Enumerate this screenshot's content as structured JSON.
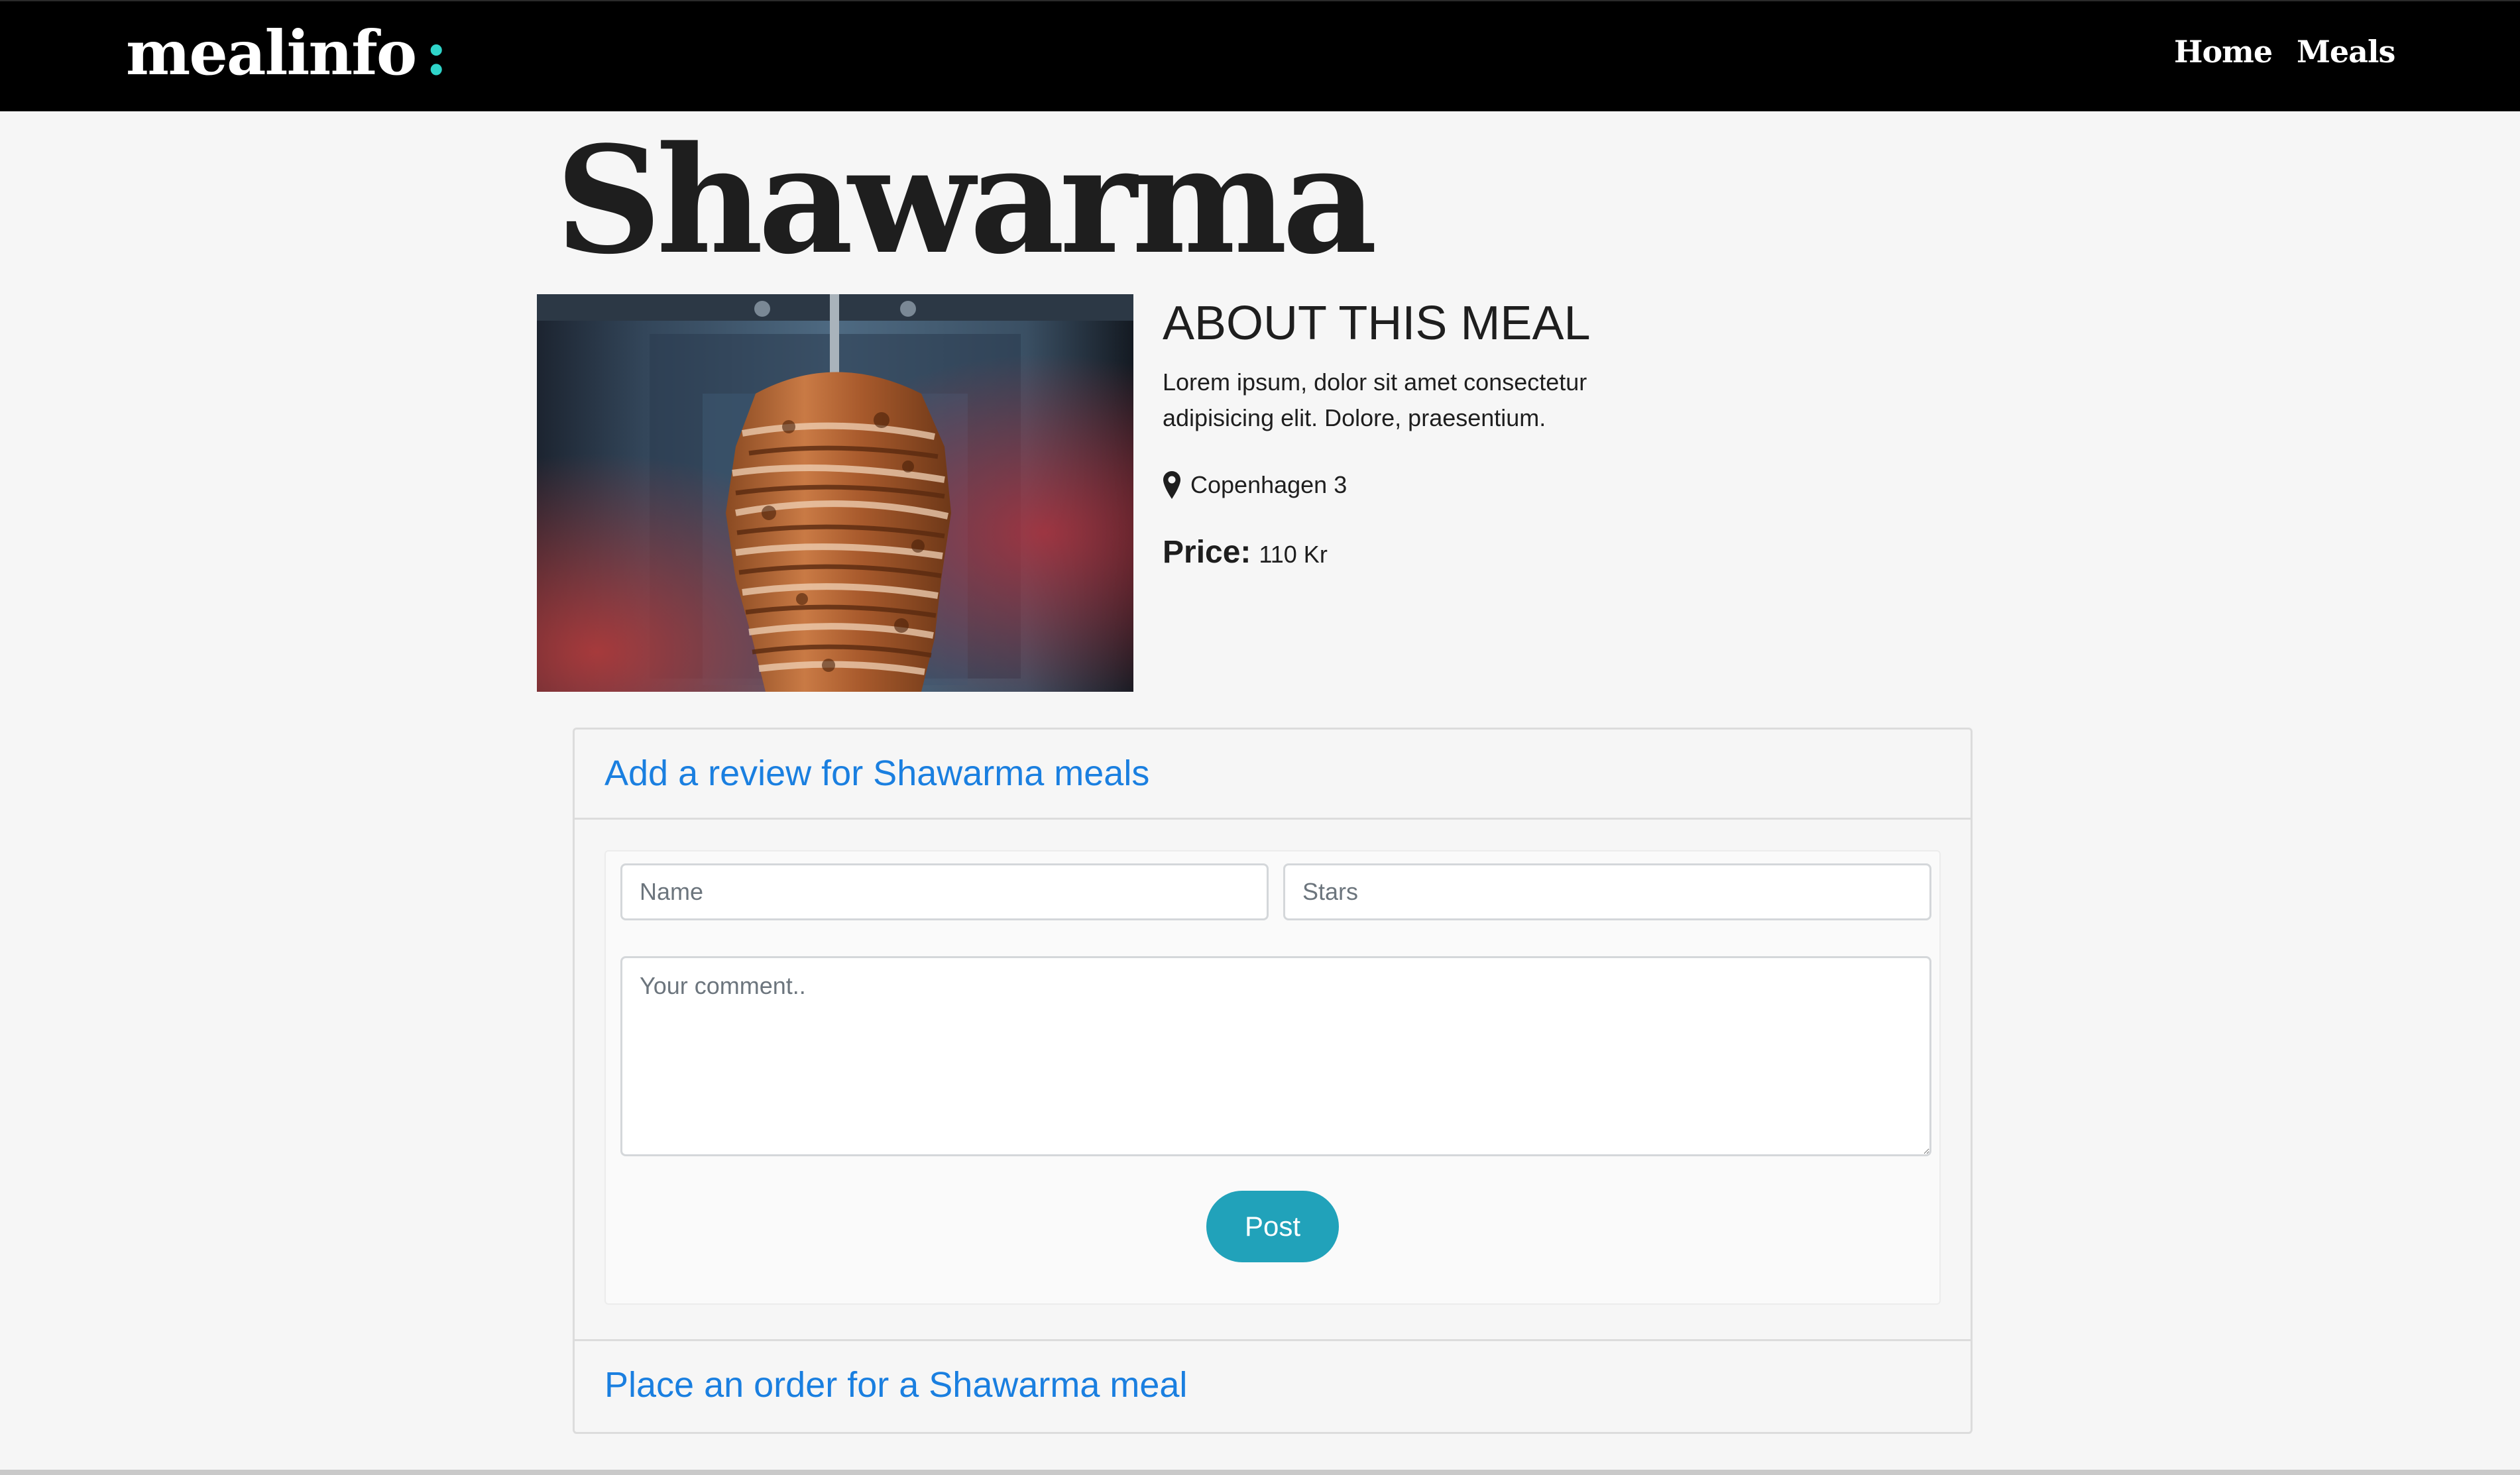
{
  "navbar": {
    "brand": "mealinfo",
    "brand_suffix": ":",
    "links": [
      {
        "label": "Home"
      },
      {
        "label": "Meals"
      }
    ]
  },
  "meal": {
    "title": "Shawarma",
    "about_heading": "ABOUT THIS MEAL",
    "description": "Lorem ipsum, dolor sit amet consectetur adipisicing elit. Dolore, praesentium.",
    "location": "Copenhagen 3",
    "price_label": "Price:",
    "price_value": "110 Kr"
  },
  "review": {
    "header": "Add a review for Shawarma meals",
    "name_placeholder": "Name",
    "stars_placeholder": "Stars",
    "comment_placeholder": "Your comment..",
    "post_label": "Post"
  },
  "order": {
    "header": "Place an order for a Shawarma meal"
  },
  "colors": {
    "navbar_bg": "#000000",
    "brand_accent": "#2fd4c9",
    "link_blue": "#1a7fe0",
    "post_button": "#21a2ba",
    "page_bg": "#f6f6f6"
  }
}
